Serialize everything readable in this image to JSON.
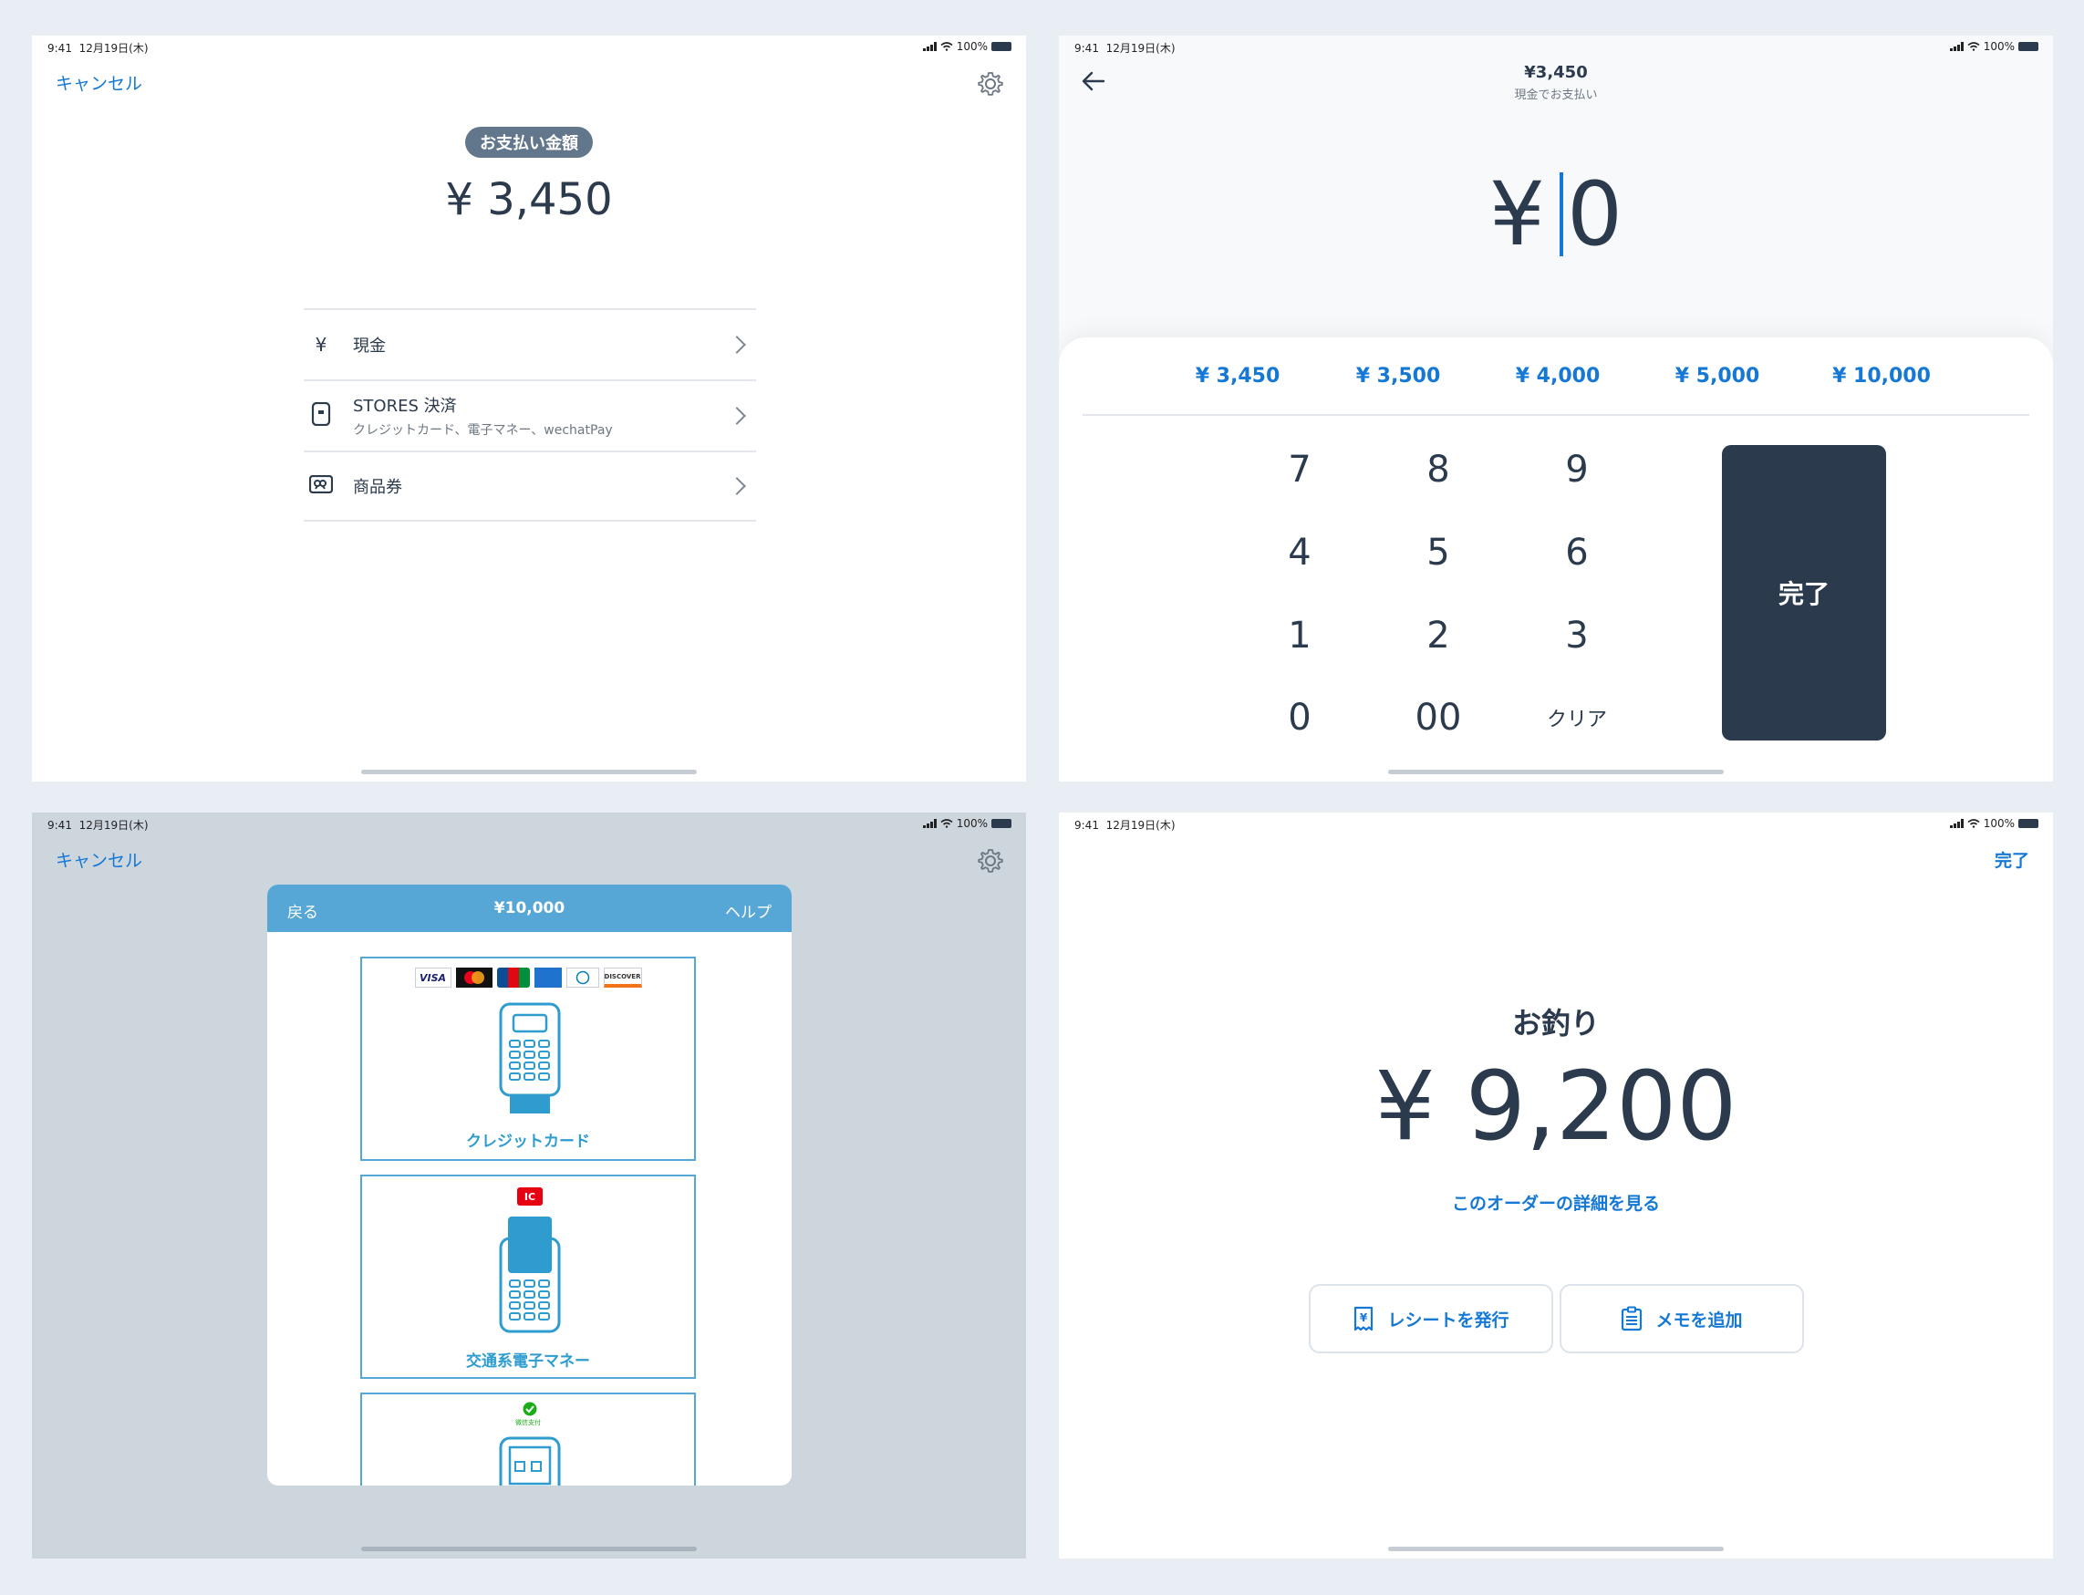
{
  "status": {
    "time": "9:41",
    "date": "12月19日(木)",
    "battery": "100%"
  },
  "screen1": {
    "cancel": "キャンセル",
    "pill": "お支払い金額",
    "amount": "¥ 3,450",
    "methods": [
      {
        "icon": "yen-icon",
        "label": "現金",
        "sub": ""
      },
      {
        "icon": "terminal-icon",
        "label": "STORES 決済",
        "sub": "クレジットカード、電子マネー、wechatPay"
      },
      {
        "icon": "voucher-icon",
        "label": "商品券",
        "sub": ""
      }
    ]
  },
  "screen2": {
    "total": "¥3,450",
    "subtitle": "現金でお支払い",
    "input_currency": "¥",
    "input_value": "0",
    "quick_amounts": [
      "¥ 3,450",
      "¥ 3,500",
      "¥ 4,000",
      "¥ 5,000",
      "¥ 10,000"
    ],
    "keys": [
      [
        "7",
        "8",
        "9"
      ],
      [
        "4",
        "5",
        "6"
      ],
      [
        "1",
        "2",
        "3"
      ],
      [
        "0",
        "00",
        "クリア"
      ]
    ],
    "done": "完了"
  },
  "screen3": {
    "cancel": "キャンセル",
    "back": "戻る",
    "amount": "¥10,000",
    "help": "ヘルプ",
    "brands": [
      "VISA",
      "Mastercard",
      "JCB",
      "AMEX",
      "Diners",
      "DISCOVER"
    ],
    "ic_label": "IC",
    "wechat_label": "微信支付",
    "cards": [
      "クレジットカード",
      "交通系電子マネー"
    ]
  },
  "screen4": {
    "done": "完了",
    "title": "お釣り",
    "amount": "¥ 9,200",
    "details_link": "このオーダーの詳細を見る",
    "receipt_button": "レシートを発行",
    "memo_button": "メモを追加"
  },
  "colors": {
    "accent": "#1478d4",
    "navy": "#2b3a4c",
    "modal_header": "#56a6d6",
    "card_blue": "#2e9ccf",
    "overlay": "#cdd5dd"
  }
}
